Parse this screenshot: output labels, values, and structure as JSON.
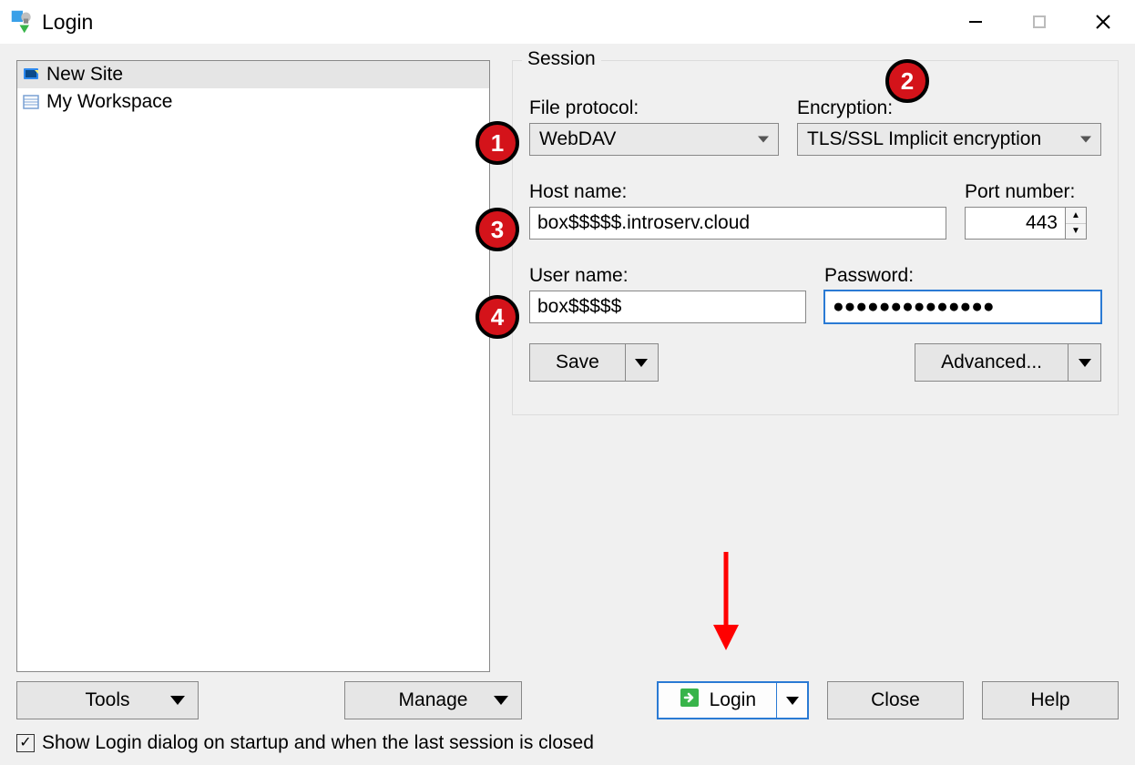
{
  "window": {
    "title": "Login"
  },
  "sidebar": {
    "items": [
      {
        "label": "New Site",
        "selected": true
      },
      {
        "label": "My Workspace",
        "selected": false
      }
    ]
  },
  "session": {
    "legend": "Session",
    "file_protocol": {
      "label": "File protocol:",
      "value": "WebDAV"
    },
    "encryption": {
      "label": "Encryption:",
      "value": "TLS/SSL Implicit encryption"
    },
    "host_name": {
      "label": "Host name:",
      "value": "box$$$$$.introserv.cloud"
    },
    "port_number": {
      "label": "Port number:",
      "value": "443"
    },
    "user_name": {
      "label": "User name:",
      "value": "box$$$$$"
    },
    "password": {
      "label": "Password:",
      "value": "●●●●●●●●●●●●●●"
    },
    "save_button": "Save",
    "advanced_button": "Advanced..."
  },
  "buttons": {
    "tools": "Tools",
    "manage": "Manage",
    "login": "Login",
    "close": "Close",
    "help": "Help"
  },
  "checkbox": {
    "label": "Show Login dialog on startup and when the last session is closed",
    "checked": true
  },
  "annotations": {
    "markers": [
      "1",
      "2",
      "3",
      "4"
    ]
  }
}
